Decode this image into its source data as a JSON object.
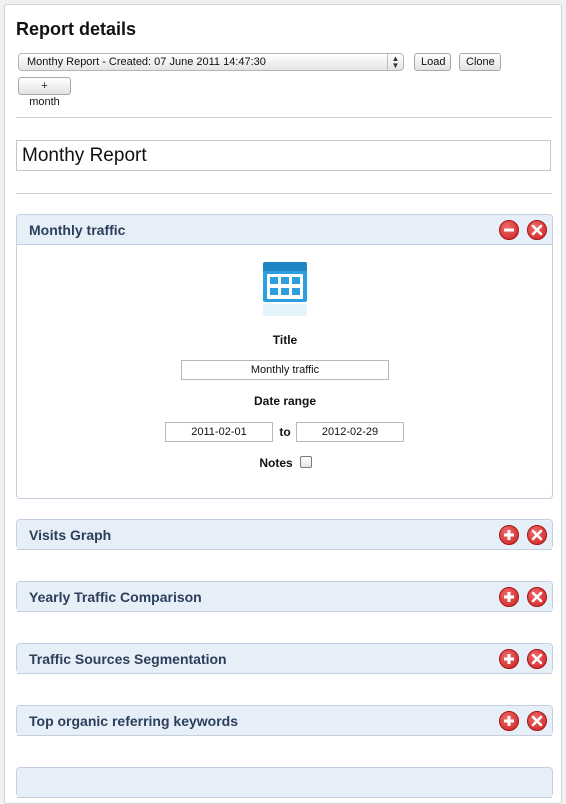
{
  "page": {
    "title": "Report details",
    "report_select": {
      "value": "Monthy Report - Created: 07 June 2011 14:47:30"
    },
    "buttons": {
      "load": "Load",
      "clone": "Clone",
      "add_month": "+ month"
    },
    "report_name": "Monthy Report"
  },
  "panels": [
    {
      "title": "Monthly traffic",
      "expanded": true,
      "title_label": "Title",
      "title_value": "Monthly traffic",
      "date_range_label": "Date range",
      "date_from": "2011-02-01",
      "date_to_label": "to",
      "date_to": "2012-02-29",
      "notes_label": "Notes",
      "notes_checked": false
    },
    {
      "title": "Visits Graph",
      "expanded": false
    },
    {
      "title": "Yearly Traffic Comparison",
      "expanded": false
    },
    {
      "title": "Traffic Sources Segmentation",
      "expanded": false
    },
    {
      "title": "Top organic referring keywords",
      "expanded": false
    }
  ],
  "icons": {
    "collapse": "minus-circle-icon",
    "expand": "plus-circle-icon",
    "close": "close-circle-icon",
    "calendar": "calendar-icon"
  },
  "colors": {
    "panel_header": "#e6eef8",
    "panel_title": "#2b3f5b",
    "control_red": "#d42a2a",
    "calendar_blue": "#2b9fe0"
  }
}
